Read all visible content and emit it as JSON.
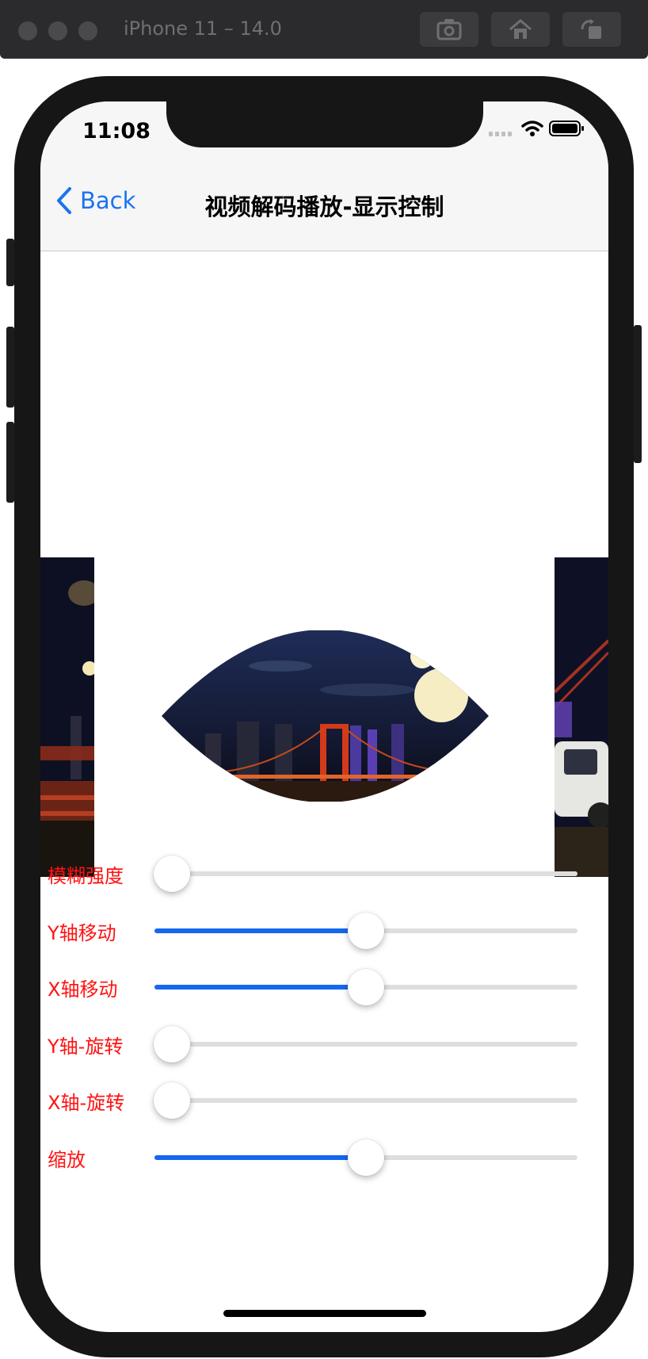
{
  "simulator": {
    "title": "iPhone 11 – 14.0",
    "buttons": [
      "screenshot-icon",
      "home-icon",
      "rotate-icon"
    ]
  },
  "status_bar": {
    "time": "11:08",
    "icons": [
      "cellular-icon",
      "wifi-icon",
      "battery-icon"
    ]
  },
  "nav": {
    "back_label": "Back",
    "title": "视频解码播放-显示控制"
  },
  "colors": {
    "accent": "#1467ef",
    "label": "#ff1212",
    "track": "#dedede"
  },
  "sliders": [
    {
      "label": "模糊强度",
      "value": 0.0
    },
    {
      "label": "Y轴移动",
      "value": 0.5
    },
    {
      "label": "X轴移动",
      "value": 0.5
    },
    {
      "label": "Y轴-旋转",
      "value": 0.0
    },
    {
      "label": "X轴-旋转",
      "value": 0.0
    },
    {
      "label": "缩放",
      "value": 0.5
    }
  ]
}
